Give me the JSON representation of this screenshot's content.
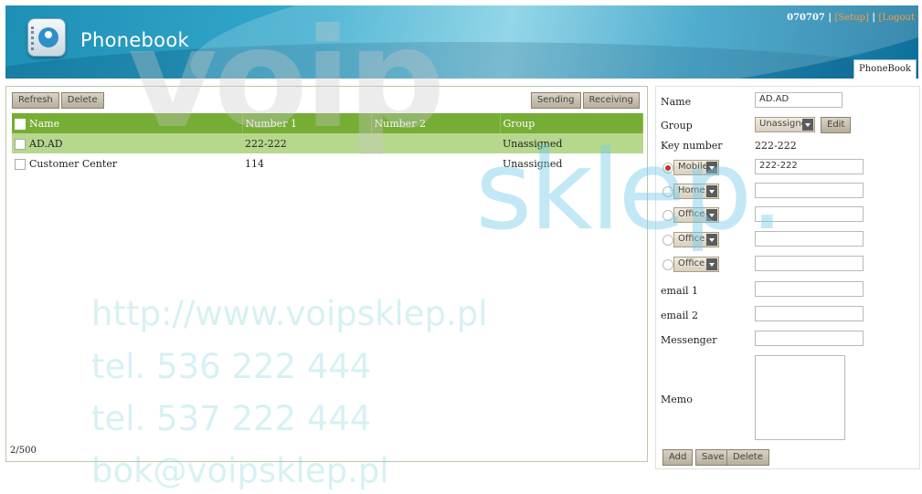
{
  "header": {
    "app_title": "Phonebook",
    "user_id": "070707",
    "setup_link": "[Setup]",
    "logout_link": "[Logout",
    "tab_label": "PhoneBook"
  },
  "toolbar": {
    "refresh": "Refresh",
    "delete": "Delete",
    "sending": "Sending",
    "receiving": "Receiving"
  },
  "table": {
    "columns": [
      "Name",
      "Number 1",
      "Number 2",
      "Group"
    ],
    "rows": [
      {
        "name": "AD.AD",
        "number1": "222-222",
        "number2": "",
        "group": "Unassigned",
        "selected": true
      },
      {
        "name": "Customer Center",
        "number1": "114",
        "number2": "",
        "group": "Unassigned",
        "selected": false
      }
    ]
  },
  "footer": {
    "count": "2/500"
  },
  "form": {
    "name_label": "Name",
    "name_value": "AD.AD",
    "group_label": "Group",
    "group_value": "Unassigned",
    "edit_button": "Edit",
    "key_number_label": "Key number",
    "key_number_value": "222-222",
    "phones": [
      {
        "type": "Mobile",
        "value": "222-222",
        "checked": true
      },
      {
        "type": "Home",
        "value": "",
        "checked": false
      },
      {
        "type": "Office",
        "value": "",
        "checked": false
      },
      {
        "type": "Office",
        "value": "",
        "checked": false
      },
      {
        "type": "Office",
        "value": "",
        "checked": false
      }
    ],
    "email1_label": "email 1",
    "email2_label": "email 2",
    "messenger_label": "Messenger",
    "memo_label": "Memo",
    "add_button": "Add",
    "save_button": "Save",
    "delete_button": "Delete"
  },
  "watermark": {
    "brand_top": "voip",
    "brand_sklep": "sklep.",
    "url": "http://www.voipsklep.pl",
    "tel1": "tel. 536 222 444",
    "tel2": "tel. 537 222 444",
    "email": "bok@voipsklep.pl"
  }
}
